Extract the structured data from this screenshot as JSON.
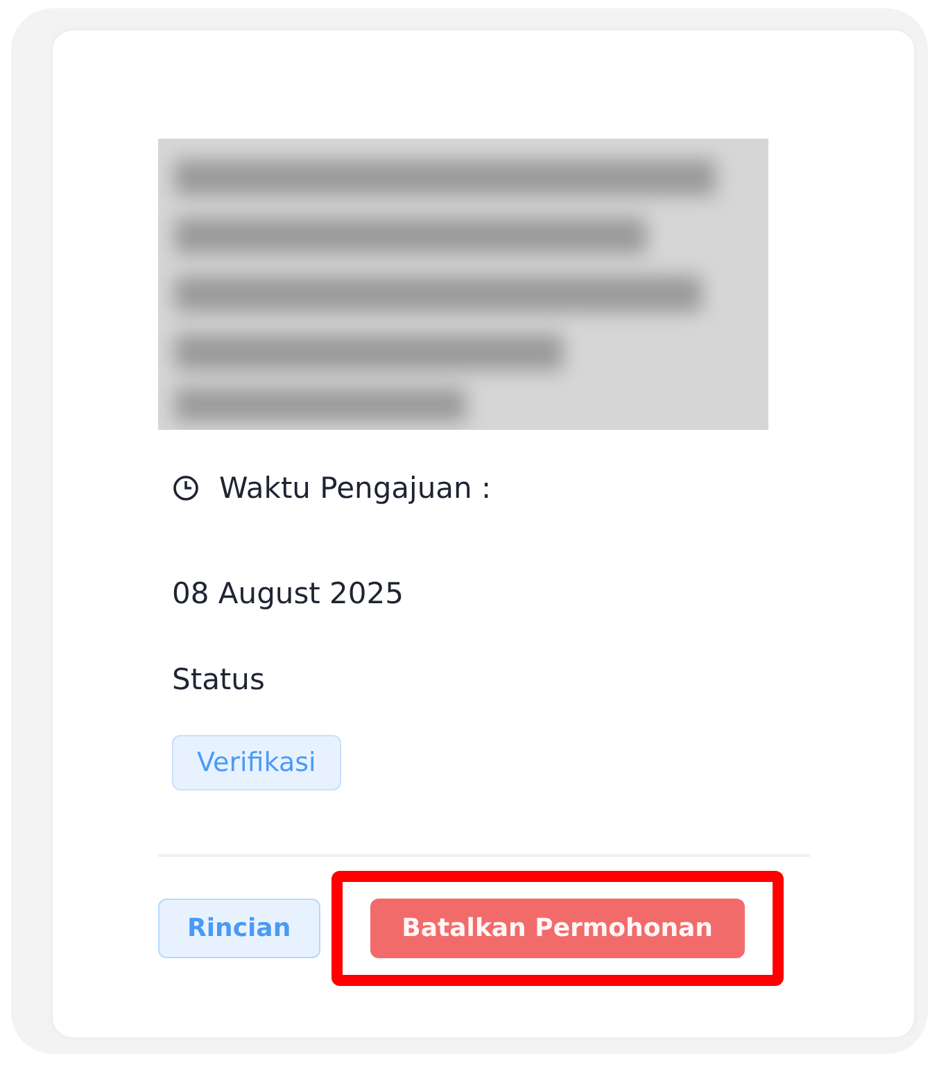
{
  "time_label": "Waktu Pengajuan :",
  "date": "08 August 2025",
  "status_label": "Status",
  "status_badge": "Verifikasi",
  "actions": [
    {
      "label": "Rincian",
      "kind": "outline",
      "highlighted": false
    },
    {
      "label": "Batalkan Permohonan",
      "kind": "danger",
      "highlighted": true
    }
  ]
}
